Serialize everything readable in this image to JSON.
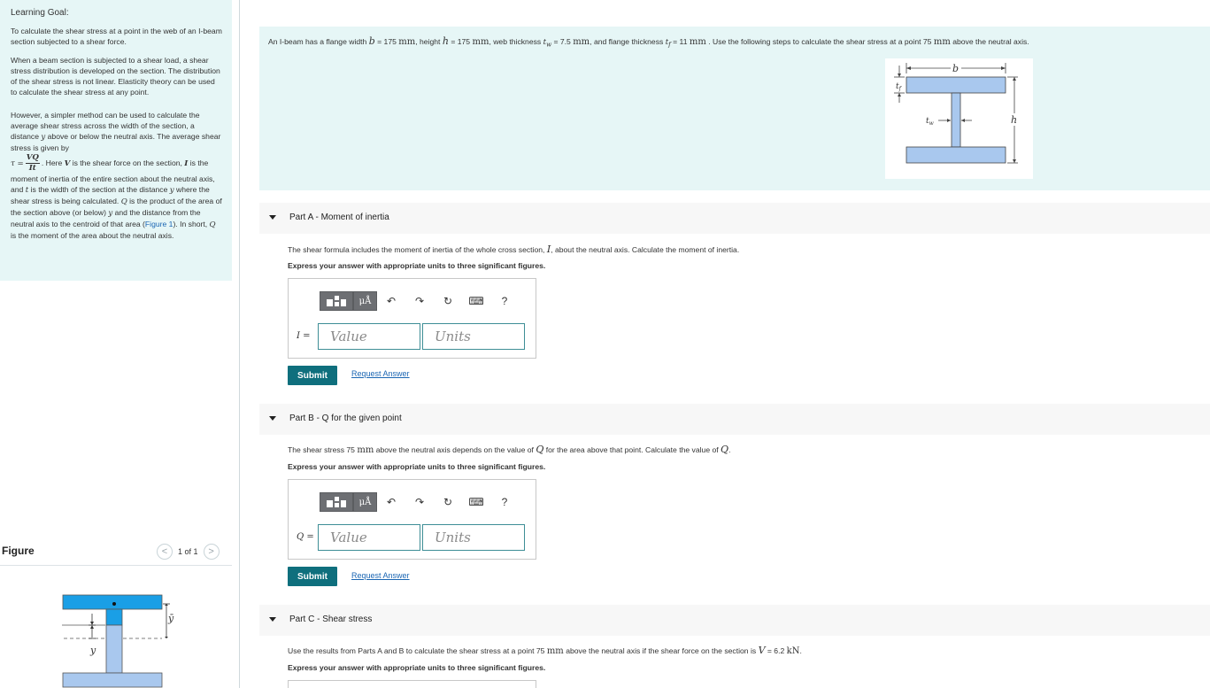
{
  "left": {
    "heading": "Learning Goal:",
    "p1": "To calculate the shear stress at a point in the web of an I-beam section subjected to a shear force.",
    "p2": "When a beam section is subjected to a shear load, a shear stress distribution is developed on the section. The distribution of the shear stress is not linear. Elasticity theory can be used to calculate the shear stress at any point.",
    "p3_a": "However, a simpler method can be used to calculate the average shear stress across the width of the section, a distance",
    "p3_b": "above or below the neutral axis. The average shear stress is given by",
    "tau": "τ =",
    "frac_num": "VQ",
    "frac_den": "It",
    "p3_c": ". Here",
    "p3_d": "is the shear force on the section,",
    "p3_e": "is the moment of inertia of the entire section about the neutral axis, and",
    "p3_f": "is the width of the section at the distance",
    "p3_g": "where the shear stress is being calculated.",
    "p3_h": "is the product of the area of the section above (or below)",
    "p3_i": "and the distance from the neutral axis to the centroid of that area (",
    "p3_link": "Figure 1",
    "p3_j": "). In short,",
    "p3_k": "is the moment of the area about the neutral axis.",
    "var_y": "y",
    "var_V": "V",
    "var_I": "I",
    "var_t": "t",
    "var_Q": "Q"
  },
  "figure": {
    "title": "Figure",
    "counter": "1 of 1",
    "prev": "<",
    "next": ">",
    "label_y_bar": "ȳ",
    "label_y": "y"
  },
  "problem": {
    "t1": "An I-beam has a flange width",
    "b": "b",
    "t2": "= 175",
    "mm": "mm",
    "t3": ", height",
    "h": "h",
    "t4": "= 175",
    "t5": ", web thickness",
    "tw": "t",
    "tw_sub": "w",
    "t6": "= 7.5",
    "t7": ", and flange thickness",
    "tf": "t",
    "tf_sub": "f",
    "t8": "= 11",
    "t9": ". Use the following steps to calculate the shear stress at a point 75",
    "t10": "above the neutral axis.",
    "diag_b": "b",
    "diag_tf": "t",
    "diag_tf_sub": "f",
    "diag_tw": "t",
    "diag_tw_sub": "w",
    "diag_h": "h"
  },
  "toolbar": {
    "mu_label": "μÅ",
    "undo": "↶",
    "redo": "↷",
    "reset": "↻",
    "keyboard": "⌨",
    "help": "?"
  },
  "partA": {
    "prefix": "Part A",
    "title": " - Moment of inertia",
    "q_a": "The shear formula includes the moment of inertia of the whole cross section,",
    "q_var": "I",
    "q_b": ", about the neutral axis. Calculate the moment of inertia.",
    "instr": "Express your answer with appropriate units to three significant figures.",
    "label": "I =",
    "value_placeholder": "Value",
    "units_placeholder": "Units",
    "submit": "Submit",
    "request": "Request Answer"
  },
  "partB": {
    "prefix": "Part B",
    "title": " - Q for the given point",
    "q_a": "The shear stress 75",
    "q_mm": "mm",
    "q_b": "above the neutral axis depends on the value of",
    "q_var": "Q",
    "q_c": "for the area above that point. Calculate the value of",
    "q_d": ".",
    "instr": "Express your answer with appropriate units to three significant figures.",
    "label": "Q =",
    "value_placeholder": "Value",
    "units_placeholder": "Units",
    "submit": "Submit",
    "request": "Request Answer"
  },
  "partC": {
    "prefix": "Part C",
    "title": " - Shear stress",
    "q_a": "Use the results from Parts A and B to calculate the shear stress at a point 75",
    "q_mm": "mm",
    "q_b": "above the neutral axis if the shear force on the section is",
    "q_var": "V",
    "q_c": "= 6.2",
    "q_unit": "kN",
    "q_d": ".",
    "instr": "Express your answer with appropriate units to three significant figures."
  },
  "colors": {
    "panel_bg": "#e6f6f6",
    "submit_bg": "#0f6f7d",
    "link": "#1b66b3",
    "beam_fill": "#a9c8ee",
    "beam_highlight": "#1a9fe6"
  }
}
